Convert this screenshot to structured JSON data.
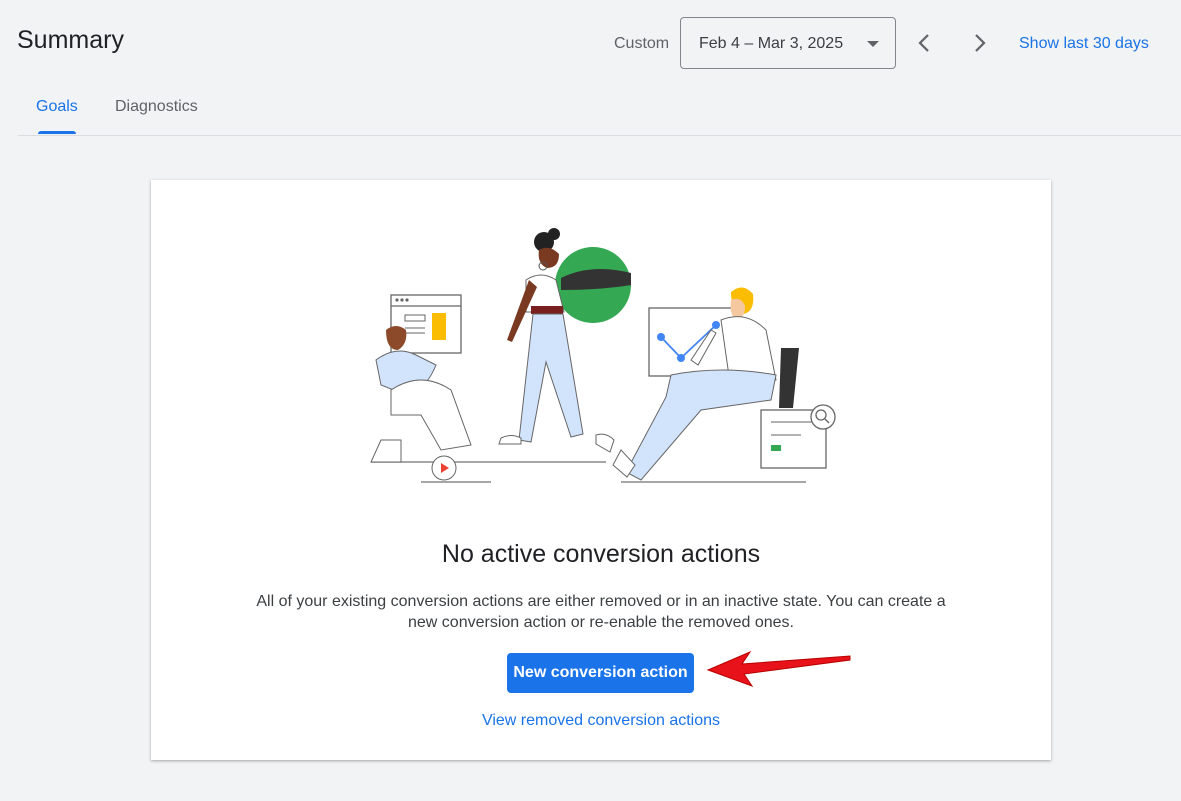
{
  "header": {
    "title": "Summary",
    "range_label": "Custom",
    "date_range": "Feb 4 – Mar 3, 2025",
    "show_last": "Show last 30 days"
  },
  "tabs": [
    {
      "label": "Goals",
      "active": true
    },
    {
      "label": "Diagnostics",
      "active": false
    }
  ],
  "empty_state": {
    "title": "No active conversion actions",
    "description": "All of your existing conversion actions are either removed or in an inactive state. You can create a new conversion action or re-enable the removed ones.",
    "primary_button": "New conversion action",
    "secondary_link": "View removed conversion actions"
  },
  "icons": {
    "prev": "chevron-left-icon",
    "next": "chevron-right-icon",
    "dropdown": "caret-down-icon"
  },
  "colors": {
    "accent": "#1a73e8",
    "annotation_arrow": "#e8121a"
  }
}
